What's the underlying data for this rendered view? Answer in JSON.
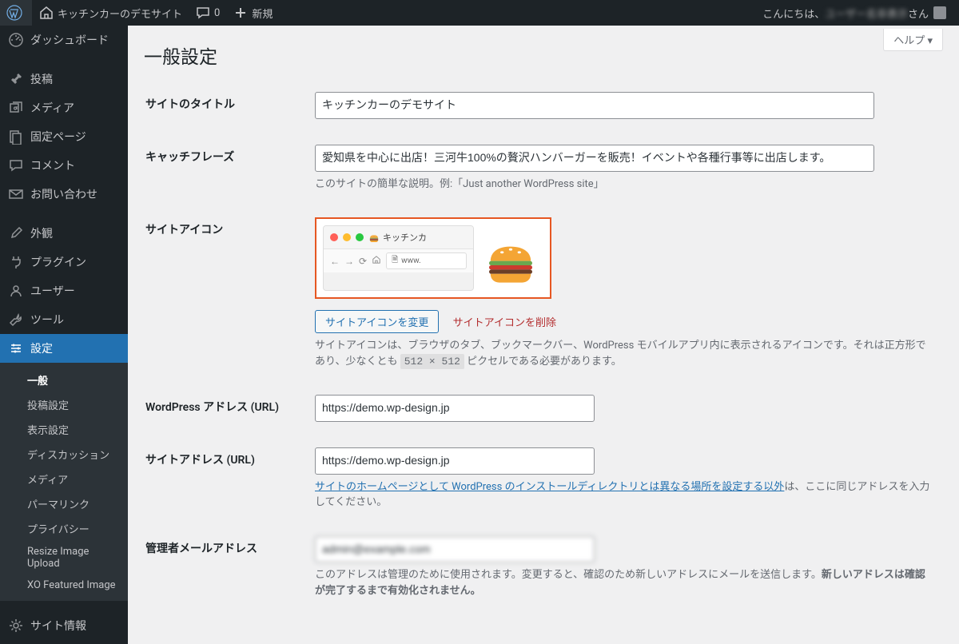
{
  "toolbar": {
    "site_name": "キッチンカーのデモサイト",
    "comments": "0",
    "new_label": "新規",
    "greeting_prefix": "こんにちは、",
    "greeting_user": "ユーザー名非表示",
    "greeting_suffix": " さん"
  },
  "sidebar": {
    "items": [
      {
        "icon": "dashboard",
        "label": "ダッシュボード"
      },
      {
        "icon": "pin",
        "label": "投稿"
      },
      {
        "icon": "media",
        "label": "メディア"
      },
      {
        "icon": "page",
        "label": "固定ページ"
      },
      {
        "icon": "comment",
        "label": "コメント"
      },
      {
        "icon": "mail",
        "label": "お問い合わせ"
      },
      {
        "icon": "brush",
        "label": "外観"
      },
      {
        "icon": "plug",
        "label": "プラグイン"
      },
      {
        "icon": "user",
        "label": "ユーザー"
      },
      {
        "icon": "wrench",
        "label": "ツール"
      },
      {
        "icon": "sliders",
        "label": "設定"
      },
      {
        "icon": "gear",
        "label": "サイト情報"
      }
    ],
    "settings_submenu": [
      "一般",
      "投稿設定",
      "表示設定",
      "ディスカッション",
      "メディア",
      "パーマリンク",
      "プライバシー",
      "Resize Image Upload",
      "XO Featured Image"
    ]
  },
  "content": {
    "help": "ヘルプ ▾",
    "page_title": "一般設定",
    "rows": {
      "site_title": {
        "label": "サイトのタイトル",
        "value": "キッチンカーのデモサイト"
      },
      "tagline": {
        "label": "キャッチフレーズ",
        "value": "愛知県を中心に出店！三河牛100%の贅沢ハンバーガーを販売！イベントや各種行事等に出店します。",
        "desc": "このサイトの簡単な説明。例:「Just another WordPress site」"
      },
      "site_icon": {
        "label": "サイトアイコン",
        "tab_text": "キッチンカ",
        "url_text": "www.",
        "change_btn": "サイトアイコンを変更",
        "remove_link": "サイトアイコンを削除",
        "desc_1": "サイトアイコンは、ブラウザのタブ、ブックマークバー、WordPress モバイルアプリ内に表示されるアイコンです。それは正方形であり、少なくとも ",
        "code": "512 × 512",
        "desc_2": " ピクセルである必要があります。"
      },
      "wp_url": {
        "label": "WordPress アドレス (URL)",
        "value": "https://demo.wp-design.jp"
      },
      "site_url": {
        "label": "サイトアドレス (URL)",
        "value": "https://demo.wp-design.jp",
        "link": "サイトのホームページとして WordPress のインストールディレクトリとは異なる場所を設定する以外",
        "rest": "は、ここに同じアドレスを入力してください。"
      },
      "admin_email": {
        "label": "管理者メールアドレス",
        "value": "admin@example.com",
        "desc_1": "このアドレスは管理のために使用されます。変更すると、確認のため新しいアドレスにメールを送信します。",
        "desc_bold": "新しいアドレスは確認が完了するまで有効化されません。"
      }
    }
  }
}
